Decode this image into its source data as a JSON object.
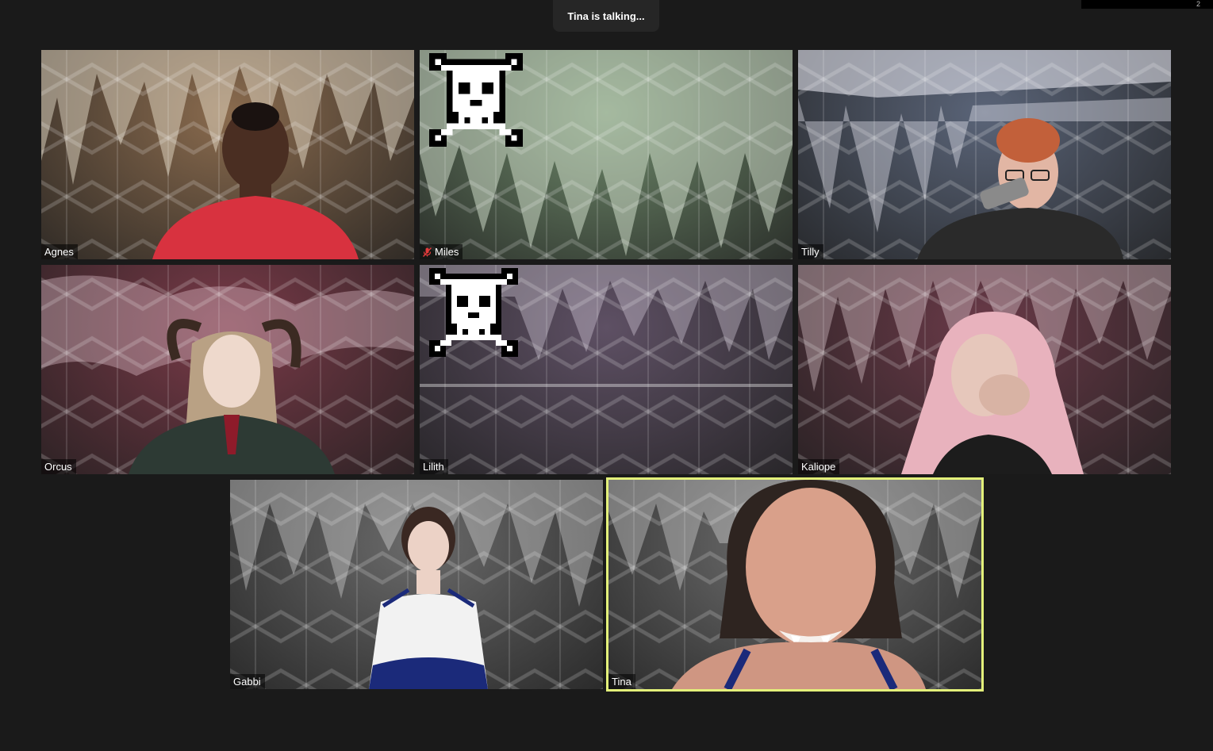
{
  "speaker_banner": "Tina is talking...",
  "corner_indicator": "2",
  "participants": [
    {
      "name": "Agnes",
      "muted": false,
      "video_off": false,
      "tint": "#8a6b4e",
      "active": false
    },
    {
      "name": "Miles",
      "muted": true,
      "video_off": true,
      "tint": "#6f8a6b",
      "active": false
    },
    {
      "name": "Tilly",
      "muted": false,
      "video_off": false,
      "tint": "#5a6478",
      "active": false
    },
    {
      "name": "Orcus",
      "muted": false,
      "video_off": false,
      "tint": "#7a3a48",
      "active": false
    },
    {
      "name": "Lilith",
      "muted": false,
      "video_off": true,
      "tint": "#5e5064",
      "active": false
    },
    {
      "name": "Kaliope",
      "muted": false,
      "video_off": false,
      "tint": "#6a3a48",
      "active": false
    },
    {
      "name": "Gabbi",
      "muted": false,
      "video_off": false,
      "tint": "#6a6a6a",
      "active": false
    },
    {
      "name": "Tina",
      "muted": false,
      "video_off": false,
      "tint": "#707070",
      "active": true
    }
  ],
  "colors": {
    "active_border": "#e3f07a",
    "muted_icon": "#e03b3b",
    "background": "#1a1a1a"
  }
}
